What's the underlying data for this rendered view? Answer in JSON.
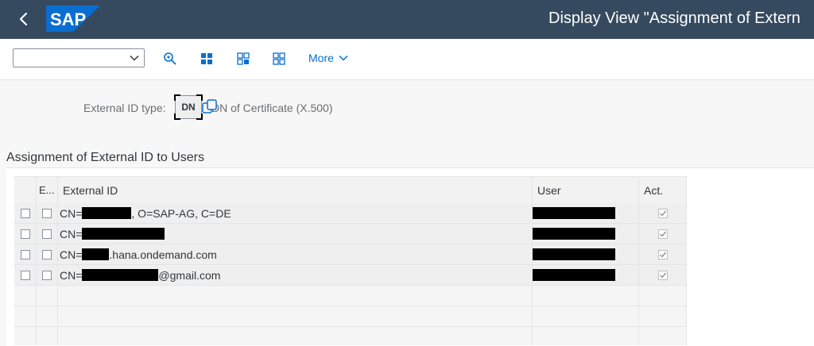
{
  "shell": {
    "logo_text": "SAP",
    "title": "Display View \"Assignment of Extern",
    "colors": {
      "shell_bg": "#354a5f",
      "accent": "#0a6ed1",
      "logo": "#0a6ed1"
    }
  },
  "toolbar": {
    "variant_value": "",
    "more_label": "More"
  },
  "header_fields": {
    "external_id_type_label": "External ID type:",
    "external_id_type_value": "DN",
    "external_id_type_desc": "DN of Certificate (X.500)"
  },
  "section_title": "Assignment of External ID to Users",
  "table": {
    "columns": [
      "E...",
      "External ID",
      "User",
      "Act."
    ],
    "rows": [
      {
        "prefix": "CN=",
        "suffix": ", O=SAP-AG, C=DE",
        "act": true
      },
      {
        "prefix": "CN=",
        "suffix": "",
        "act": true
      },
      {
        "prefix": "CN=",
        "suffix": ".hana.ondemand.com",
        "act": true
      },
      {
        "prefix": "CN=",
        "suffix": "@gmail.com",
        "act": true
      }
    ]
  }
}
